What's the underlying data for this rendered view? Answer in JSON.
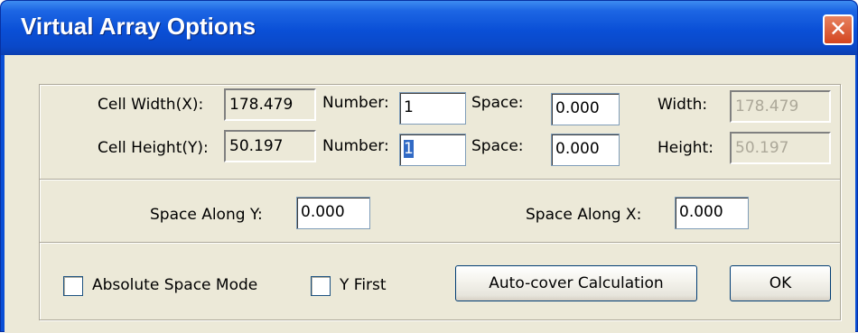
{
  "window": {
    "title": "Virtual Array Options",
    "close_glyph": "✕"
  },
  "row_x": {
    "cell_label": "Cell Width(X):",
    "cell_value": "178.479",
    "number_label": "Number:",
    "number_value": "1",
    "space_label": "Space:",
    "space_value": "0.000",
    "total_label": "Width:",
    "total_value": "178.479"
  },
  "row_y": {
    "cell_label": "Cell Height(Y):",
    "cell_value": "50.197",
    "number_label": "Number:",
    "number_value": "1",
    "space_label": "Space:",
    "space_value": "0.000",
    "total_label": "Height:",
    "total_value": "50.197"
  },
  "spacing": {
    "along_y_label": "Space Along Y:",
    "along_y_value": "0.000",
    "along_x_label": "Space Along X:",
    "along_x_value": "0.000"
  },
  "options": {
    "absolute_space_mode_label": "Absolute Space Mode",
    "absolute_space_mode_checked": false,
    "y_first_label": "Y First",
    "y_first_checked": false
  },
  "buttons": {
    "auto_cover_label": "Auto-cover Calculation",
    "ok_label": "OK"
  },
  "colors": {
    "titlebar": "#0a4fd6",
    "dialog_face": "#ece9d8",
    "selection": "#316ac5",
    "close_button": "#d4451f"
  }
}
